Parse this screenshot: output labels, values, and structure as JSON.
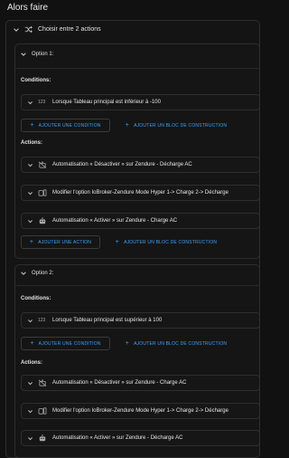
{
  "page": {
    "title": "Alors faire"
  },
  "choose": {
    "label": "Choisir entre 2 actions"
  },
  "options": [
    {
      "title": "Option 1:",
      "conditions_label": "Conditions:",
      "condition": {
        "icon_text": "123",
        "text": "Lorsque Tableau principal est inférieur à -100"
      },
      "add_condition": "AJOUTER UNE CONDITION",
      "add_block_1": "AJOUTER UN BLOC DE CONSTRUCTION",
      "actions_label": "Actions:",
      "actions": [
        {
          "icon": "robot-off-icon",
          "text": "Automatisation « Désactiver » sur Zendure - Décharge AC"
        },
        {
          "icon": "device-icon",
          "text": "Modifier l'option IoBroker-Zendure Mode Hyper 1-> Charge 2-> Décharge"
        },
        {
          "icon": "robot-icon",
          "text": "Automatisation « Activer » sur Zendure - Charge AC"
        }
      ],
      "add_action": "AJOUTER UNE ACTION",
      "add_block_2": "AJOUTER UN BLOC DE CONSTRUCTION"
    },
    {
      "title": "Option 2:",
      "conditions_label": "Conditions:",
      "condition": {
        "icon_text": "123",
        "text": "Lorsque Tableau principal est supérieur à 100"
      },
      "add_condition": "AJOUTER UNE CONDITION",
      "add_block_1": "AJOUTER UN BLOC DE CONSTRUCTION",
      "actions_label": "Actions:",
      "actions": [
        {
          "icon": "robot-off-icon",
          "text": "Automatisation « Désactiver » sur Zendure - Charge AC"
        },
        {
          "icon": "device-icon",
          "text": "Modifier l'option IoBroker-Zendure Mode Hyper 1-> Charge 2-> Décharge"
        },
        {
          "icon": "robot-icon",
          "text": "Automatisation « Activer » sur Zendure - Décharge AC"
        }
      ]
    }
  ],
  "colors": {
    "accent": "#3aa3ff",
    "background": "#111111",
    "border": "#2e2e2e"
  }
}
